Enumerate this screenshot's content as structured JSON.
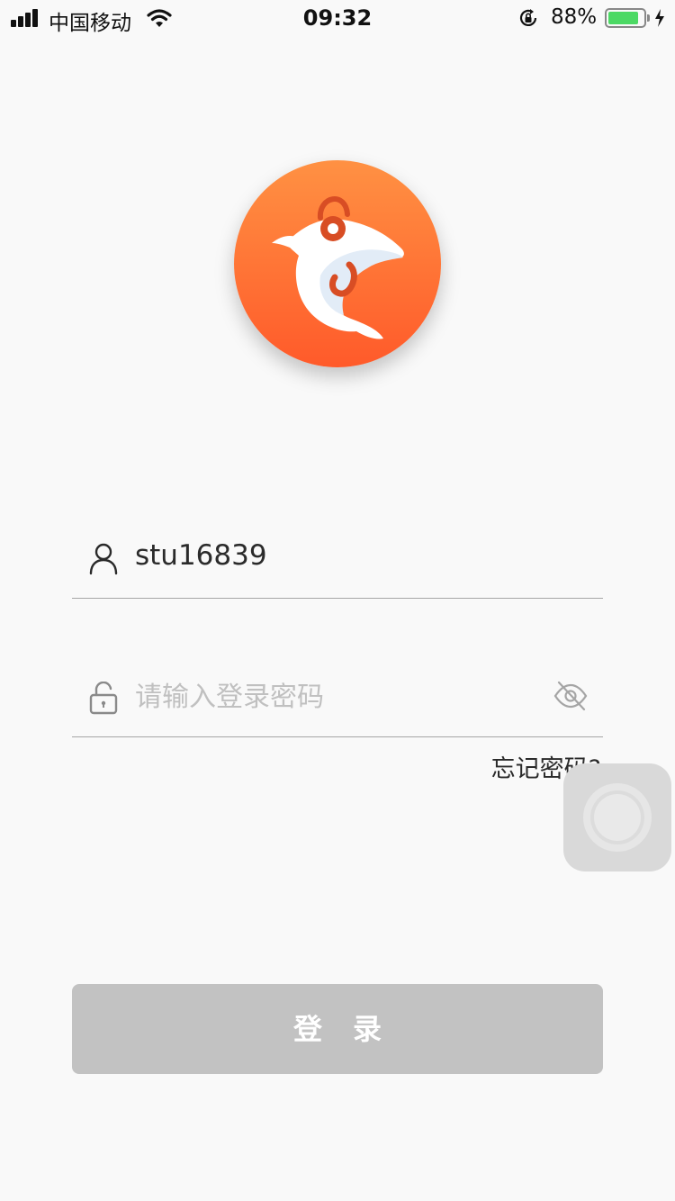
{
  "status_bar": {
    "carrier": "中国移动",
    "time": "09:32",
    "battery_percent": "88%",
    "battery_level": 0.88,
    "icons": [
      "signal-icon",
      "wifi-icon",
      "rotation-lock-icon",
      "battery-icon",
      "charging-icon"
    ]
  },
  "logo": {
    "icon": "dolphin-headphones-logo",
    "gradient": [
      "#ff9143",
      "#ff5a2a"
    ]
  },
  "login_form": {
    "username": {
      "value": "stu16839",
      "icon": "user-icon"
    },
    "password": {
      "placeholder": "请输入登录密码",
      "icon": "lock-icon",
      "toggle_icon": "eye-hidden-icon"
    },
    "forgot_password": "忘记密码?",
    "submit_label": "登录"
  },
  "colors": {
    "background": "#f9f9f9",
    "button_disabled": "#c2c2c2",
    "brand": "#ff7a35"
  }
}
